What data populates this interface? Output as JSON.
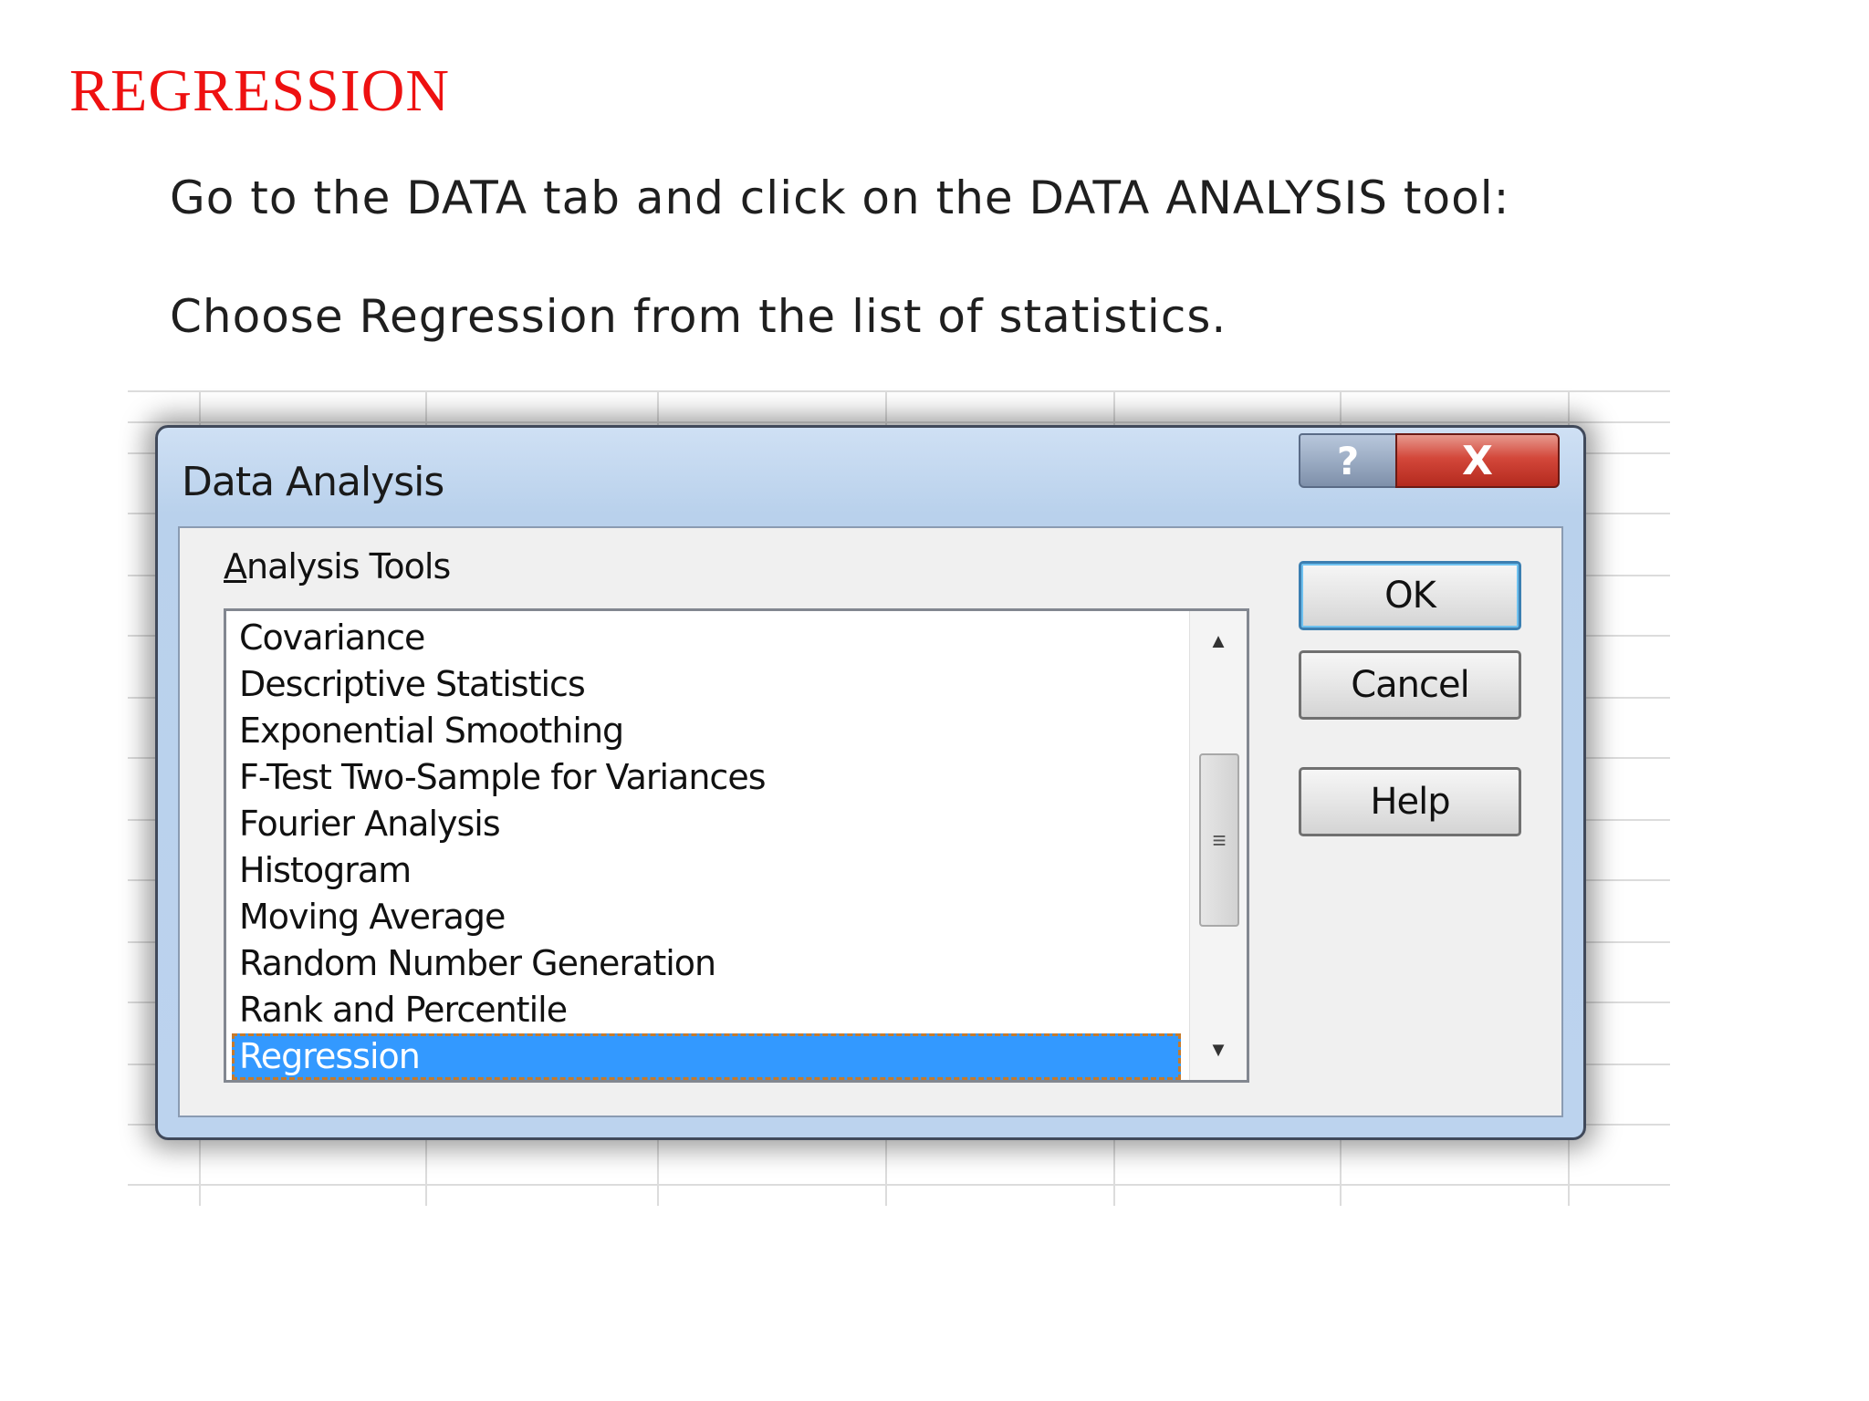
{
  "slide": {
    "title": "REGRESSION",
    "instruction_1": "Go to the DATA tab and click on the DATA ANALYSIS tool:",
    "instruction_2": "Choose Regression from the list of statistics."
  },
  "dialog": {
    "title": "Data Analysis",
    "help_icon": "?",
    "close_icon": "X",
    "group_label_first": "A",
    "group_label_rest": "nalysis Tools",
    "items": [
      "Covariance",
      "Descriptive Statistics",
      "Exponential Smoothing",
      "F-Test Two-Sample for Variances",
      "Fourier Analysis",
      "Histogram",
      "Moving Average",
      "Random Number Generation",
      "Rank and Percentile",
      "Regression"
    ],
    "selected_item": "Regression",
    "ok_label": "OK",
    "cancel_label": "Cancel",
    "help_label": "Help"
  },
  "colors": {
    "title_red": "#ee1111",
    "selection_blue": "#3399ff",
    "close_red": "#c83a2d"
  },
  "icons": {
    "scroll_up": "scroll-up-arrow-icon",
    "scroll_down": "scroll-down-arrow-icon",
    "scroll_grip": "scroll-grip-icon"
  }
}
